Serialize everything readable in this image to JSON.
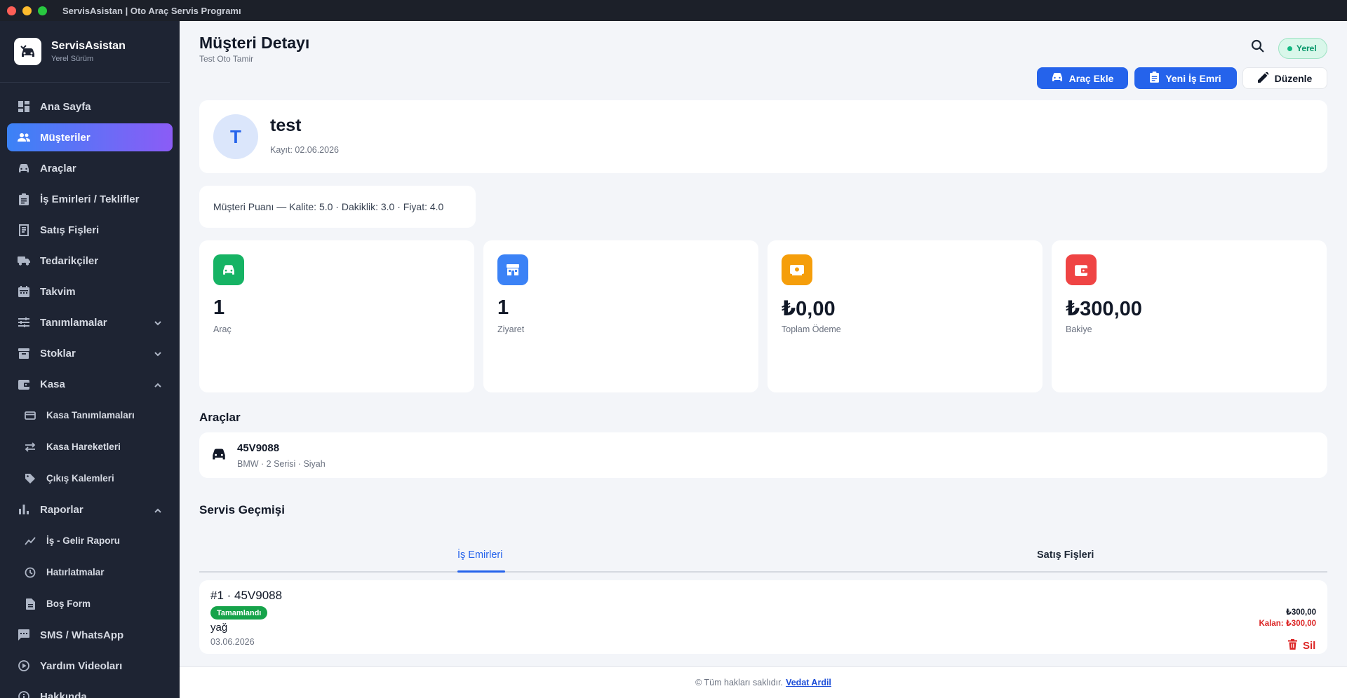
{
  "window": {
    "title": "ServisAsistan | Oto Araç Servis Programı"
  },
  "brand": {
    "name": "ServisAsistan",
    "subtitle": "Yerel Sürüm"
  },
  "sidebar": {
    "items": [
      {
        "label": "Ana Sayfa",
        "icon": "dashboard-icon"
      },
      {
        "label": "Müşteriler",
        "icon": "people-icon",
        "active": true
      },
      {
        "label": "Araçlar",
        "icon": "car-icon"
      },
      {
        "label": "İş Emirleri / Teklifler",
        "icon": "clipboard-icon"
      },
      {
        "label": "Satış Fişleri",
        "icon": "receipt-icon"
      },
      {
        "label": "Tedarikçiler",
        "icon": "truck-icon"
      },
      {
        "label": "Takvim",
        "icon": "calendar-icon"
      },
      {
        "label": "Tanımlamalar",
        "icon": "tune-icon",
        "expandable": "collapsed"
      },
      {
        "label": "Stoklar",
        "icon": "archive-icon",
        "expandable": "collapsed"
      },
      {
        "label": "Kasa",
        "icon": "wallet-icon",
        "expandable": "expanded"
      },
      {
        "label": "Kasa Tanımlamaları",
        "icon": "card-icon",
        "sub": true
      },
      {
        "label": "Kasa Hareketleri",
        "icon": "swap-icon",
        "sub": true
      },
      {
        "label": "Çıkış Kalemleri",
        "icon": "tag-icon",
        "sub": true
      },
      {
        "label": "Raporlar",
        "icon": "bar-chart-icon",
        "expandable": "expanded"
      },
      {
        "label": "İş - Gelir Raporu",
        "icon": "trend-icon",
        "sub": true
      },
      {
        "label": "Hatırlatmalar",
        "icon": "clock-icon",
        "sub": true
      },
      {
        "label": "Boş Form",
        "icon": "file-icon",
        "sub": true
      },
      {
        "label": "SMS / WhatsApp",
        "icon": "chat-icon"
      },
      {
        "label": "Yardım Videoları",
        "icon": "play-circle-icon"
      },
      {
        "label": "Hakkında",
        "icon": "info-icon"
      }
    ]
  },
  "header": {
    "title": "Müşteri Detayı",
    "subtitle": "Test Oto Tamir",
    "mode_badge": "Yerel"
  },
  "actions": {
    "add_vehicle": "Araç Ekle",
    "new_work_order": "Yeni İş Emri",
    "edit": "Düzenle"
  },
  "customer": {
    "initial": "T",
    "name": "test",
    "registered": "Kayıt: 02.06.2026",
    "rating": "Müşteri Puanı — Kalite: 5.0 · Dakiklik: 3.0 · Fiyat: 4.0"
  },
  "stats": [
    {
      "value": "1",
      "label": "Araç",
      "color": "#16b364",
      "icon": "car-icon"
    },
    {
      "value": "1",
      "label": "Ziyaret",
      "color": "#3b82f6",
      "icon": "store-icon"
    },
    {
      "value": "₺0,00",
      "label": "Toplam Ödeme",
      "color": "#f59e0b",
      "icon": "cash-icon"
    },
    {
      "value": "₺300,00",
      "label": "Bakiye",
      "color": "#ef4444",
      "icon": "wallet-icon"
    }
  ],
  "vehicles_section": {
    "title": "Araçlar",
    "items": [
      {
        "plate": "45V9088",
        "desc": "BMW · 2 Serisi · Siyah"
      }
    ]
  },
  "history": {
    "title": "Servis Geçmişi",
    "tabs": [
      {
        "label": "İş Emirleri",
        "active": true
      },
      {
        "label": "Satış Fişleri"
      }
    ],
    "orders": [
      {
        "title": "#1 · 45V9088",
        "status": "Tamamlandı",
        "description": "yağ",
        "date": "03.06.2026",
        "amount": "₺300,00",
        "remaining": "Kalan: ₺300,00"
      }
    ],
    "delete_label": "Sil"
  },
  "footer": {
    "text": "© Tüm hakları saklıdır.",
    "author": "Vedat Ardil"
  },
  "colors": {
    "accent": "#2563eb",
    "sidebar_bg": "#1e2433",
    "danger": "#dc2626",
    "success": "#16a34a"
  }
}
